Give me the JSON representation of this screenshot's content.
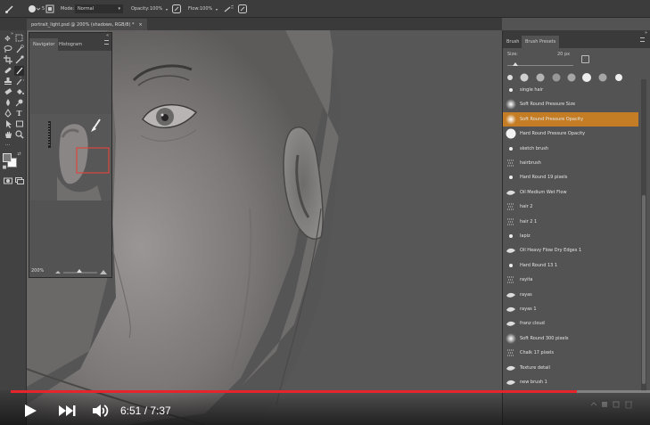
{
  "options_bar": {
    "mode_label": "Mode:",
    "mode_value": "Normal",
    "opacity_label": "Opacity:",
    "opacity_value": "100%",
    "flow_label": "Flow:",
    "flow_value": "100%",
    "brush_size": "5"
  },
  "document_tab": {
    "title": "portrait_light.psd @ 200% (shadows, RGB/8) *"
  },
  "navigator": {
    "tab_navigator": "Navigator",
    "tab_histogram": "Histogram",
    "zoom": "200%"
  },
  "brush_panel": {
    "tab_brush": "Brush",
    "tab_presets": "Brush Presets",
    "size_label": "Size:",
    "size_value": "20 px",
    "items": [
      {
        "label": "single hair",
        "size": "",
        "icon": "dot"
      },
      {
        "label": "Soft Round Pressure Size",
        "size": "",
        "icon": "soft"
      },
      {
        "label": "Soft Round Pressure Opacity",
        "size": "",
        "icon": "soft",
        "selected": true
      },
      {
        "label": "Hard Round Pressure Opacity",
        "size": "",
        "icon": "hard"
      },
      {
        "label": "sketch brush",
        "size": "",
        "icon": "dot"
      },
      {
        "label": "hairbrush",
        "size": "",
        "icon": "tex"
      },
      {
        "label": "Hard Round 19 pixels",
        "size": "",
        "icon": "dot"
      },
      {
        "label": "Oil Medium Wet Flow",
        "size": "",
        "icon": "flake"
      },
      {
        "label": "hair 2",
        "size": "",
        "icon": "tex"
      },
      {
        "label": "hair 2 1",
        "size": "",
        "icon": "tex"
      },
      {
        "label": "lapiz",
        "size": "",
        "icon": "dot"
      },
      {
        "label": "Oil Heavy Flow Dry Edges 1",
        "size": "",
        "icon": "flake"
      },
      {
        "label": "Hard Round 13 1",
        "size": "",
        "icon": "dot"
      },
      {
        "label": "rayita",
        "size": "",
        "icon": "tex"
      },
      {
        "label": "rayas",
        "size": "",
        "icon": "flake"
      },
      {
        "label": "rayas 1",
        "size": "",
        "icon": "flake"
      },
      {
        "label": "franz cloud",
        "size": "",
        "icon": "flake"
      },
      {
        "label": "Soft Round 300 pixels",
        "size": "",
        "icon": "soft"
      },
      {
        "label": "Chalk 17 pixels",
        "size": "",
        "icon": "tex"
      },
      {
        "label": "Texture detail",
        "size": "",
        "icon": "flake"
      },
      {
        "label": "new brush 1",
        "size": "",
        "icon": "flake"
      }
    ]
  },
  "player": {
    "progress": 0.885,
    "time": "6:51 / 7:37"
  },
  "colors": {
    "accent": "#c47d24",
    "progress": "#e5252b"
  }
}
